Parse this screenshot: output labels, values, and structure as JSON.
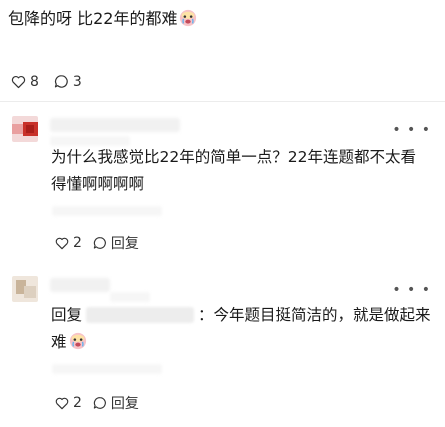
{
  "post": {
    "text": "包降的呀 比22年的都难"
  },
  "post_actions": {
    "like_count": "8",
    "comment_count": "3"
  },
  "comments": [
    {
      "text": "为什么我感觉比22年的简单一点？22年连题都不太看得懂啊啊啊啊",
      "like_count": "2",
      "reply_label": "回复"
    },
    {
      "reply_prefix": "回复",
      "text": "：今年题目挺简洁的，就是做起来难",
      "like_count": "2",
      "reply_label": "回复"
    }
  ],
  "icons": {
    "like": "heart-outline-icon",
    "comment": "speech-bubble-icon",
    "more": "more-dots-icon",
    "emoji": "crying-face-emoji"
  }
}
